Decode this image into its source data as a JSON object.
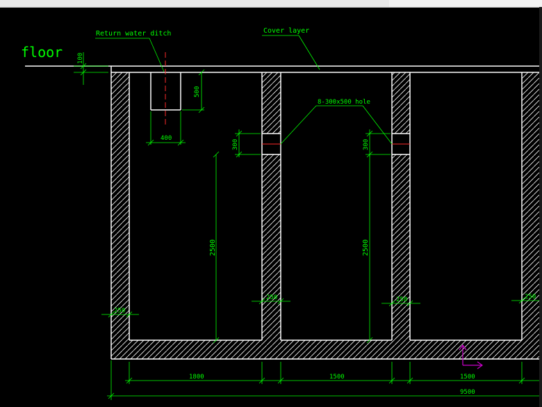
{
  "labels": {
    "floor": "floor",
    "return_water_ditch": "Return water ditch",
    "cover_layer": "Cover layer",
    "hole": "8-300x500 hole"
  },
  "dims": {
    "d100": "100",
    "d500": "500",
    "d400": "400",
    "d300a": "300",
    "d300b": "300",
    "d2500a": "2500",
    "d2500b": "2500",
    "w250a": "250",
    "w250b": "250",
    "w250c": "250",
    "w250d": "250",
    "d1800": "1800",
    "d1500a": "1500",
    "d1500b": "1500",
    "d9500": "9500"
  },
  "colors": {
    "background": "#000000",
    "lines": "#ffffff",
    "dimensions": "#00ff00",
    "axis": "#cc00cc",
    "centerline": "#ff2a2a"
  }
}
